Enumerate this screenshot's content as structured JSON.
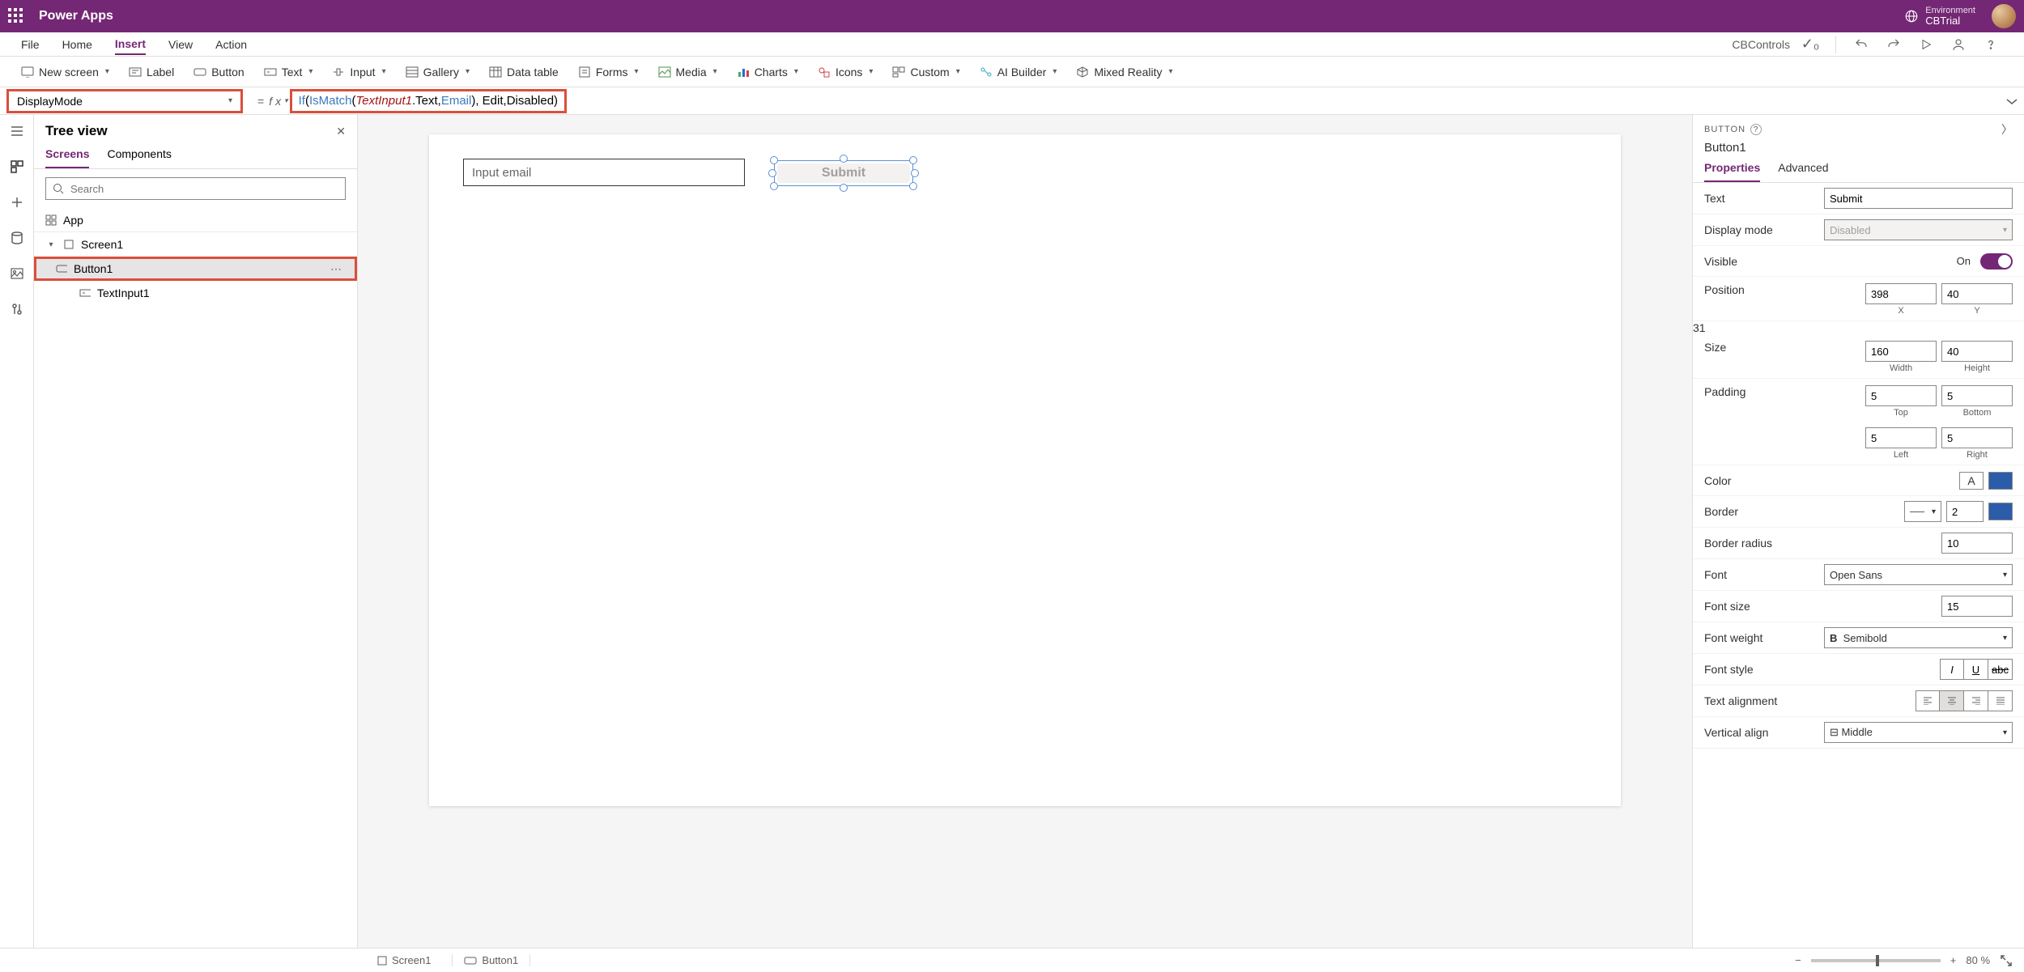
{
  "header": {
    "title": "Power Apps",
    "environment_label": "Environment",
    "environment_name": "CBTrial"
  },
  "menu": {
    "items": [
      "File",
      "Home",
      "Insert",
      "View",
      "Action"
    ],
    "active": "Insert",
    "app_name": "CBControls"
  },
  "ribbon": [
    {
      "label": "New screen",
      "chev": true
    },
    {
      "label": "Label"
    },
    {
      "label": "Button"
    },
    {
      "label": "Text",
      "chev": true
    },
    {
      "label": "Input",
      "chev": true
    },
    {
      "label": "Gallery",
      "chev": true
    },
    {
      "label": "Data table"
    },
    {
      "label": "Forms",
      "chev": true
    },
    {
      "label": "Media",
      "chev": true
    },
    {
      "label": "Charts",
      "chev": true
    },
    {
      "label": "Icons",
      "chev": true
    },
    {
      "label": "Custom",
      "chev": true
    },
    {
      "label": "AI Builder",
      "chev": true
    },
    {
      "label": "Mixed Reality",
      "chev": true
    }
  ],
  "formula": {
    "property": "DisplayMode",
    "tokens": {
      "if": "If",
      "ismatch": "IsMatch",
      "textinput": "TextInput1",
      "prop": ".Text, ",
      "email": "Email",
      "editdis": "), Edit,Disabled)"
    }
  },
  "tree": {
    "title": "Tree view",
    "tabs": [
      "Screens",
      "Components"
    ],
    "active_tab": "Screens",
    "search_placeholder": "Search",
    "app": "App",
    "screen": "Screen1",
    "items": [
      {
        "name": "Button1",
        "selected": true
      },
      {
        "name": "TextInput1"
      }
    ]
  },
  "canvas": {
    "input_placeholder": "Input email",
    "button_label": "Submit"
  },
  "props": {
    "type": "BUTTON",
    "name": "Button1",
    "tabs": [
      "Properties",
      "Advanced"
    ],
    "active_tab": "Properties",
    "rows": {
      "text": {
        "label": "Text",
        "value": "Submit"
      },
      "display_mode": {
        "label": "Display mode",
        "value": "Disabled"
      },
      "visible": {
        "label": "Visible",
        "value": "On"
      },
      "position": {
        "label": "Position",
        "x": "398",
        "y": "40",
        "xl": "X",
        "yl": "Y"
      },
      "size": {
        "label": "Size",
        "w": "160",
        "h": "40",
        "wl": "Width",
        "hl": "Height"
      },
      "padding": {
        "label": "Padding",
        "t": "5",
        "b": "5",
        "l": "5",
        "r": "5",
        "tl": "Top",
        "bl": "Bottom",
        "ll": "Left",
        "rl": "Right"
      },
      "color": {
        "label": "Color"
      },
      "border": {
        "label": "Border",
        "value": "2"
      },
      "border_radius": {
        "label": "Border radius",
        "value": "10"
      },
      "font": {
        "label": "Font",
        "value": "Open Sans"
      },
      "font_size": {
        "label": "Font size",
        "value": "15"
      },
      "font_weight": {
        "label": "Font weight",
        "value": "Semibold"
      },
      "font_style": {
        "label": "Font style"
      },
      "text_align": {
        "label": "Text alignment"
      },
      "valign": {
        "label": "Vertical align",
        "value": "Middle"
      }
    }
  },
  "footer": {
    "screen": "Screen1",
    "button": "Button1",
    "zoom": "80",
    "pct": "%"
  }
}
